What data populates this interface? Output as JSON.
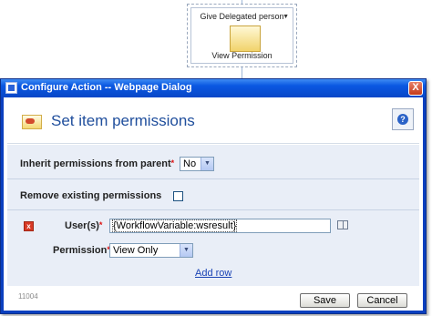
{
  "workflow": {
    "action_title": "Give Delegated person",
    "action_label": "View Permission",
    "action_icon": "key-icon"
  },
  "dialog": {
    "title": "Configure Action -- Webpage Dialog",
    "close_symbol": "X",
    "header_title": "Set item permissions",
    "help_symbol": "?",
    "inherit": {
      "label": "Inherit permissions from parent",
      "required_mark": "*",
      "value": "No"
    },
    "remove": {
      "label": "Remove existing permissions",
      "checked": false
    },
    "users": {
      "label": "User(s)",
      "required_mark": "*",
      "value": "{WorkflowVariable:wsresult}"
    },
    "permission": {
      "label": "Permission",
      "required_mark": "*",
      "value": "View Only"
    },
    "add_row": "Add row",
    "version": "11004",
    "save_label": "Save",
    "cancel_label": "Cancel"
  },
  "colors": {
    "titlebar": "#0a58e2",
    "accent_title": "#1f4e9c",
    "form_bg": "#e9eef7",
    "link": "#1b44b5",
    "required": "#dd1111"
  }
}
